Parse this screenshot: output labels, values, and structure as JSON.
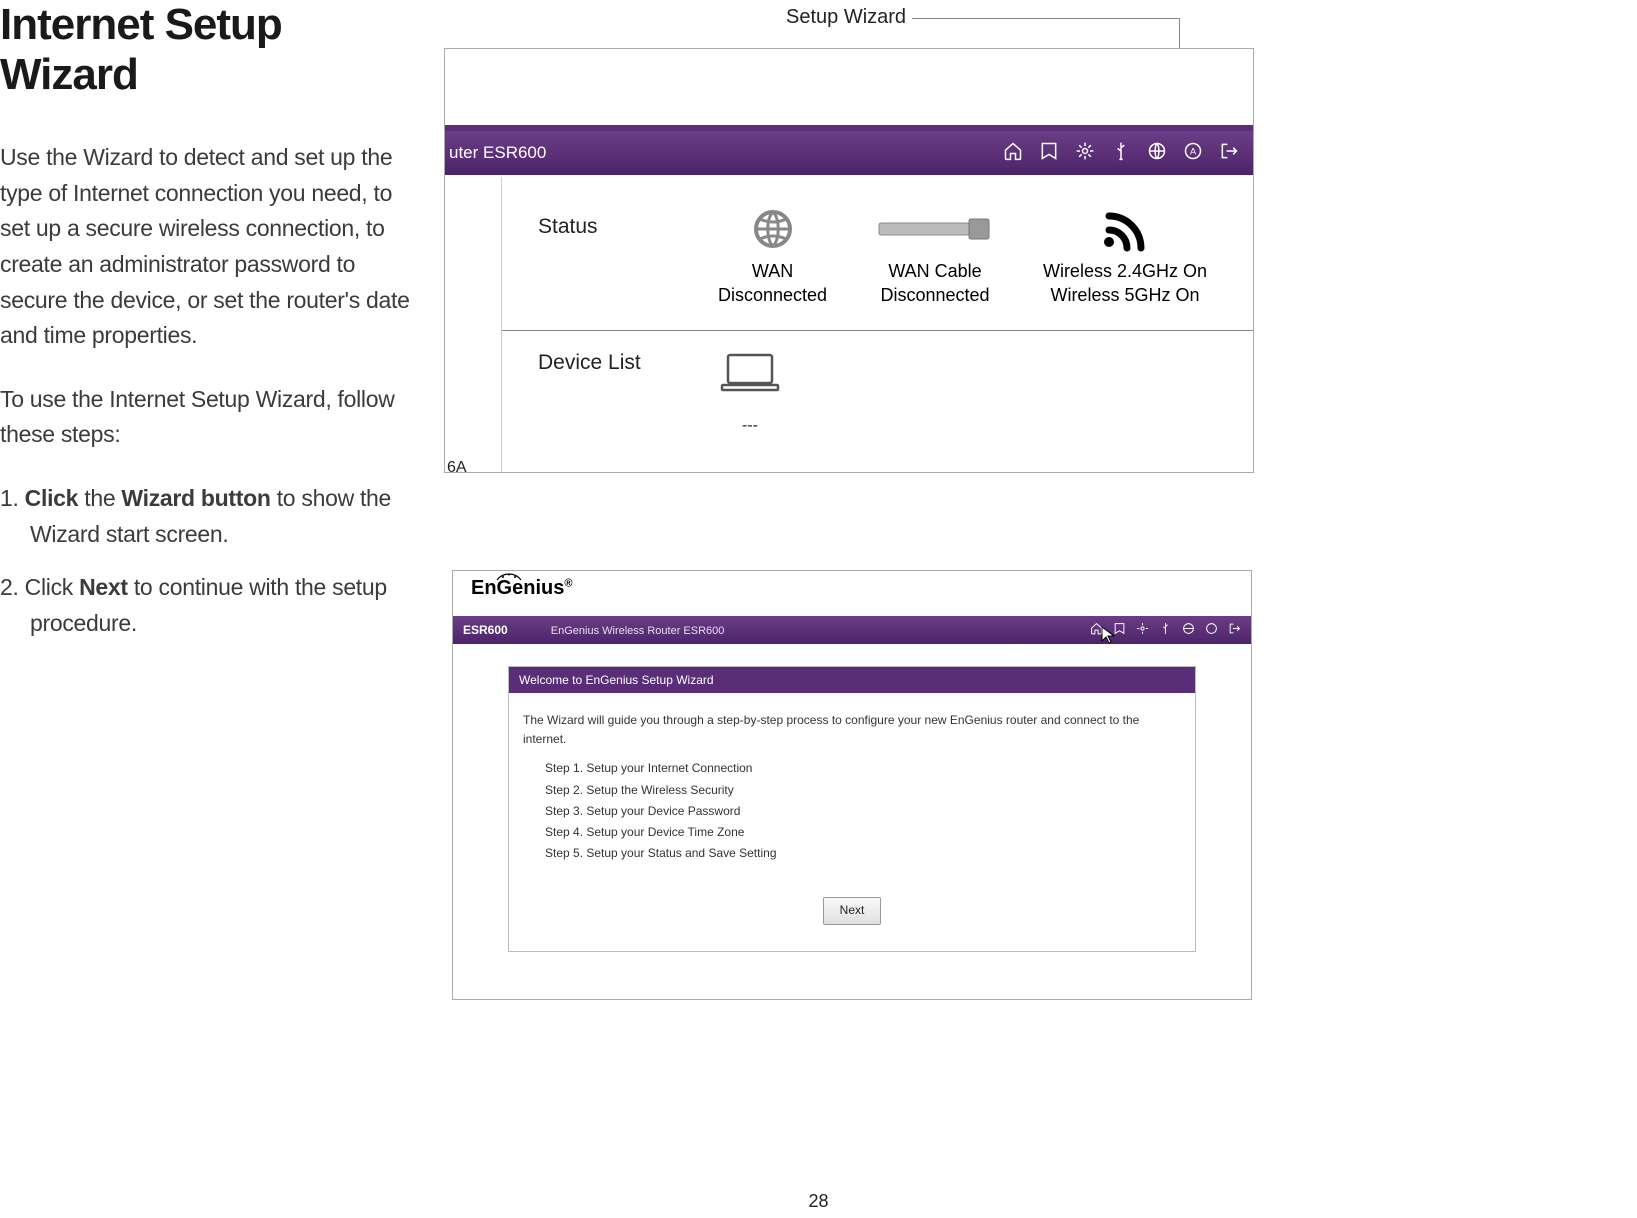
{
  "page_number": "28",
  "doc": {
    "title": "Internet Setup Wizard",
    "para1": "Use the Wizard to detect and set up the type of Internet connection you need, to set up a secure wireless connection, to create an administrator password to secure the device, or set the router's date and time properties.",
    "para2": "To use the Internet Setup Wizard, follow these steps:",
    "step1": {
      "num": "1. ",
      "t1": "Click",
      "t2": " the ",
      "t3": "Wizard button",
      "t4": " to show the ",
      "t5": "Wizard start screen."
    },
    "step2": {
      "num": "2. ",
      "t1": "Click ",
      "t2": "Next",
      "t3": " to continue with the setup ",
      "t4": "procedure."
    }
  },
  "callouts": {
    "setup_wizard": "Setup Wizard",
    "home": "Home"
  },
  "shot1": {
    "breadcrumb_fragment": "uter ESR600",
    "bottom_fragment": "6A",
    "status_label": "Status",
    "device_list_label": "Device List",
    "wan": {
      "l1": "WAN",
      "l2": "Disconnected"
    },
    "cable": {
      "l1": "WAN Cable",
      "l2": "Disconnected"
    },
    "wifi": {
      "l1": "Wireless 2.4GHz On",
      "l2": "Wireless 5GHz On"
    },
    "device_placeholder": "---"
  },
  "shot2": {
    "brand": "EnGenius",
    "reg": "®",
    "model": "ESR600",
    "model_desc": "EnGenius Wireless Router ESR600",
    "panel_title": "Welcome to EnGenius Setup Wizard",
    "intro": "The Wizard will guide you through a step-by-step process to configure your new EnGenius router and connect to the internet.",
    "steps": [
      "Step 1. Setup your Internet Connection",
      "Step 2. Setup the Wireless Security",
      "Step 3. Setup your Device Password",
      "Step 4. Setup your Device Time Zone",
      "Step 5. Setup your Status and Save Setting"
    ],
    "next": "Next"
  }
}
